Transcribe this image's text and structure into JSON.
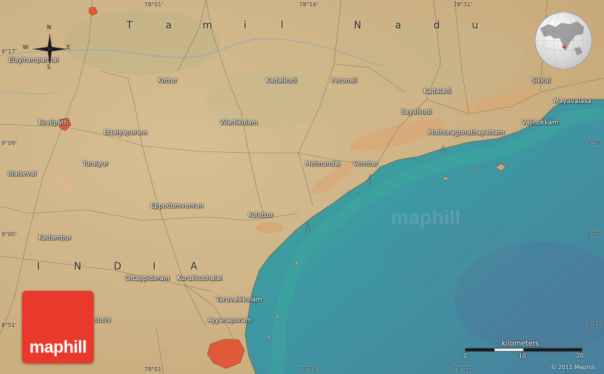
{
  "map": {
    "region_label_letters_tamil": [
      "T",
      "a",
      "m",
      "i",
      "l"
    ],
    "region_label_letters_nadu": [
      "N",
      "a",
      "d",
      "u"
    ],
    "region_label_letters_india": [
      "I",
      "N",
      "D",
      "I",
      "A"
    ],
    "places": [
      {
        "name": "Elayirampannai"
      },
      {
        "name": "Kottur"
      },
      {
        "name": "Kadalkudi"
      },
      {
        "name": "Perunali"
      },
      {
        "name": "Kadaladi"
      },
      {
        "name": "Sikkal"
      },
      {
        "name": "Mayavalasa"
      },
      {
        "name": "Sayalkudi"
      },
      {
        "name": "Valinokkam"
      },
      {
        "name": "Muthuragunathapattam"
      },
      {
        "name": "Kovilpatti"
      },
      {
        "name": "Ettaiyapuram"
      },
      {
        "name": "Vilattikulam"
      },
      {
        "name": "Melmandai"
      },
      {
        "name": "Vembar"
      },
      {
        "name": "Turaiyur"
      },
      {
        "name": "Idaiseval"
      },
      {
        "name": "Eppodumvenran"
      },
      {
        "name": "Kulattur"
      },
      {
        "name": "Kadambur"
      },
      {
        "name": "Ottappidaram"
      },
      {
        "name": "Kurukkuchalai"
      },
      {
        "name": "Taruvaikkulam"
      },
      {
        "name": "Ayyanapuram"
      },
      {
        "name": "chchi"
      }
    ],
    "coordinates": {
      "top": [
        "78°01'",
        "78°16'",
        "78°31'"
      ],
      "bottom": [
        "78°01'",
        "78°16'",
        "78°31'"
      ],
      "left": [
        "9°17'",
        "9°09'",
        "9°00'",
        "8°51'"
      ],
      "right": [
        "9°09'",
        "9°00'",
        "8°51'"
      ]
    },
    "compass": {
      "n": "N",
      "s": "S",
      "e": "E",
      "w": "W"
    },
    "logo": "maphill",
    "scale": {
      "title": "kilometers",
      "ticks": [
        "0",
        "10",
        "20"
      ]
    },
    "copyright": "© 2011 Maphill",
    "colors": {
      "land": "#cdb48a",
      "sea": "#3f9aa2",
      "town": "#e05a3a",
      "logo": "#e8392c"
    }
  }
}
